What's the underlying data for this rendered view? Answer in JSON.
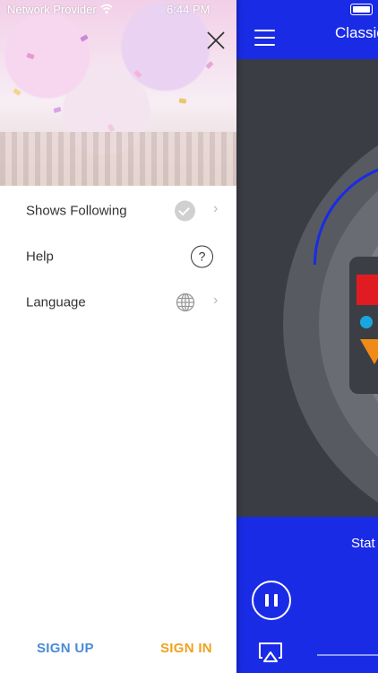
{
  "status_bar": {
    "carrier": "Network Provider",
    "time": "6:44 PM"
  },
  "drawer": {
    "menu": [
      {
        "label": "Shows Following",
        "icon": "check-circle-icon",
        "has_chevron": true
      },
      {
        "label": "Help",
        "icon": "question-circle-icon",
        "has_chevron": false
      },
      {
        "label": "Language",
        "icon": "globe-icon",
        "has_chevron": true
      }
    ],
    "chevron": "›",
    "help_glyph": "?",
    "sign_up_label": "SIGN UP",
    "sign_in_label": "SIGN IN"
  },
  "player": {
    "title": "Classic",
    "station_label": "Stat",
    "colors": {
      "brand_blue": "#1a2be6",
      "stage_dark": "#3a3d43",
      "sign_up": "#4a8ad8",
      "sign_in": "#f0a21e"
    }
  }
}
